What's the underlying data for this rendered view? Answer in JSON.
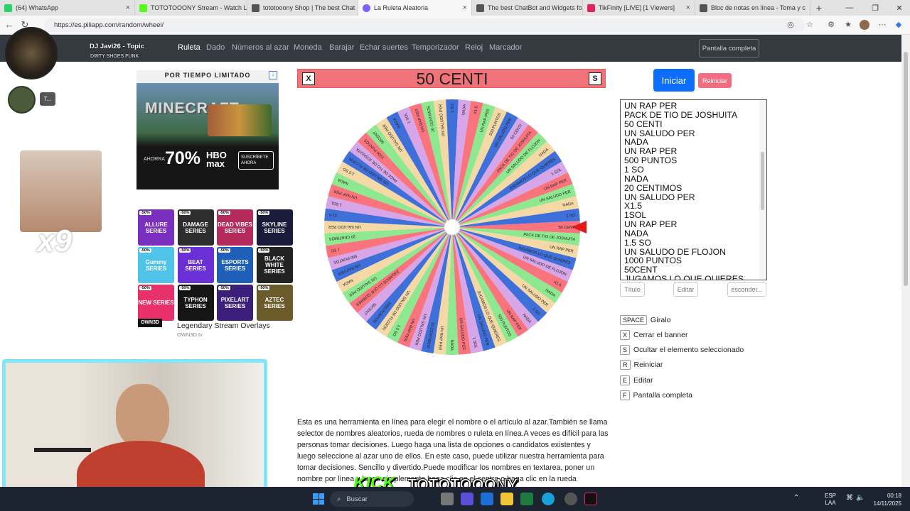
{
  "browser": {
    "tabs": [
      {
        "label": "(64) WhatsApp",
        "color": "#25d366"
      },
      {
        "label": "TOTOTOOONY Stream - Watch Li",
        "color": "#53fc18"
      },
      {
        "label": "tototooony Shop | The best Chat",
        "color": "#555555"
      },
      {
        "label": "La Ruleta Aleatoria",
        "color": "#7b61ff",
        "active": true
      },
      {
        "label": "The best ChatBot and Widgets fo",
        "color": "#555555"
      },
      {
        "label": "TikFinity [LIVE] [1 Viewers]",
        "color": "#e0245e"
      },
      {
        "label": "Bloc de notas en línea - Toma y c",
        "color": "#555555"
      }
    ],
    "url": "https://es.piliapp.com/random/wheel/"
  },
  "overlay": {
    "song_title": "DJ Javi26 - Topic",
    "song_subtitle": "DIRTY SHOES FUNK",
    "chat_badge": "T...",
    "emote_multiplier": "x9",
    "kick_watermark": "TOTOTOOONY"
  },
  "nav": {
    "links": [
      "Ruleta",
      "Dado",
      "Números al azar",
      "Moneda",
      "Barajar",
      "Echar suertes",
      "Temporizador",
      "Reloj",
      "Marcador"
    ],
    "fullscreen_label": "Pantalla completa"
  },
  "ads": {
    "ad1_tag": "POR TIEMPO LIMITADO",
    "ad1_game": "MINECRAFT",
    "ad1_discount": "70%",
    "ad1_save": "AHORRA",
    "ad1_brand": "HBO max",
    "ad1_cta": "SUSCRÍBETE AHORA",
    "ad2_tiles": [
      {
        "label": "ALLURE SERIES",
        "color": "#7a2fbf"
      },
      {
        "label": "DAMAGE SERIES",
        "color": "#2d2d2d"
      },
      {
        "label": "DEAD VIBES SERIES",
        "color": "#b42a5a"
      },
      {
        "label": "SKYLINE SERIES",
        "color": "#1a1a3a"
      },
      {
        "label": "Gummy SERIES",
        "color": "#4fc3e8"
      },
      {
        "label": "BEAT SERIES",
        "color": "#6b2fd6"
      },
      {
        "label": "ESPORTS SERIES",
        "color": "#1f5fb8"
      },
      {
        "label": "BLACK WHITE SERIES",
        "color": "#222222"
      },
      {
        "label": "NEW SERIES",
        "color": "#e8306a"
      },
      {
        "label": "TYPHON SERIES",
        "color": "#151515"
      },
      {
        "label": "PIXELART SERIES",
        "color": "#3b1f7a"
      },
      {
        "label": "AZTEC SERIES",
        "color": "#6b5a2a"
      }
    ],
    "ad2_discount": "-50%",
    "ad2_title": "Legendary Stream Overlays",
    "ad2_brand": "OWN3D",
    "ad2_domain": "OWN3D.tv"
  },
  "wheel": {
    "selected": "50 CENTI",
    "close_key": "X",
    "hide_key": "S",
    "colors": [
      "#f9747c",
      "#8de88f",
      "#f4d9a6",
      "#3f6fd8",
      "#d6a6e8"
    ],
    "segments": [
      "50 CENTI",
      "PACK DE TIO DE JOSHUITA",
      "UN RAP PER",
      "JUGAMOS LO QUE QUIERES",
      "UN SALUDO DE FLOJON",
      "X1.5",
      "NADA",
      "UN SALUDO PER",
      "1 SO",
      "NADA",
      "UN RAP PER",
      "500 PUNTOS",
      "JUGAMOS LO QUE QUIERES",
      "UN SALUDO PER",
      "1 SOL",
      "UN SALUDO PER",
      "NADA",
      "UN RAP PER",
      "20 CENTIMOS",
      "UN SALUDO PER",
      "UN RAP PER",
      "1.5 SO",
      "UN SALUDO DE FLOJON",
      "1000 PUNTOS",
      "50CENT",
      "JUGAMOS LO QUE QUIERES",
      "UN SALUDO PER",
      "NADA",
      "UN RAP PER",
      "500 PUNTOS",
      "1 SO",
      "20 CENTIMOS",
      "UN SALUDO PER",
      "X1.5",
      "1 SOL",
      "UN RAP PER",
      "NADA",
      "1.5 SO",
      "UN SALUDO DE FLOJON",
      "PACK DE TIO DE JOSHUITA",
      "1000 PUNTOS",
      "50CENT",
      "UN SALUDO PER",
      "NADA",
      "1 SOL",
      "UN RAP PER",
      "20 CENTIMOS",
      "UN SALUDO PER",
      "1 SO",
      "NADA",
      "X1.5",
      "UN RAP PER",
      "500 PUNTOS",
      "UN SALUDO PER",
      "50 CENTI",
      "PACK DE TIO DE JOSHUITA",
      "UN SALUDO DE FLOJON",
      "NADA",
      "JUGAMOS LO QUE QUIERES",
      "1 SOL",
      "UN RAP PER",
      "UN SALUDO PER",
      "NADA",
      "1 SO"
    ]
  },
  "controls": {
    "start": "Iniciar",
    "reset": "Reiniciar",
    "textarea_lines": [
      "UN RAP PER",
      "PACK DE TIO DE JOSHUITA",
      "50 CENTI",
      "UN SALUDO PER",
      "NADA",
      "UN RAP PER",
      "500 PUNTOS",
      "1 SO",
      "NADA",
      "20 CENTIMOS",
      "UN SALUDO PER",
      "X1.5",
      "1SOL",
      "UN RAP PER",
      "NADA",
      "1.5 SO",
      "UN SALUDO DE FLOJON",
      "1000 PUNTOS",
      "50CENT",
      "JUGAMOS LO QUE QUIERES"
    ],
    "title_btn": "Título",
    "edit_btn": "Editar",
    "hide_btn": "esconder..."
  },
  "shortcuts": [
    {
      "key": "SPACE",
      "label": "Gíralo"
    },
    {
      "key": "X",
      "label": "Cerrar el banner"
    },
    {
      "key": "S",
      "label": "Ocultar el elemento seleccionado"
    },
    {
      "key": "R",
      "label": "Reiniciar"
    },
    {
      "key": "E",
      "label": "Editar"
    },
    {
      "key": "F",
      "label": "Pantalla completa"
    }
  ],
  "description": "Esta es una herramienta en línea para elegir el nombre o el artículo al azar.También se llama selector de nombres aleatorios, rueda de nombres o ruleta en línea.A veces es difícil para las personas tomar decisiones. Luego haga una lista de opciones o candidatos existentes y luego seleccione al azar uno de ellos. En este caso, puede utilizar nuestra herramienta para tomar decisiones. Sencillo y divertido.Puede modificar los nombres en textarea, poner un nombre por línea y luego simplemente haga clic en el centro o haga clic en la rueda",
  "taskbar": {
    "search": "Buscar",
    "lang1": "ESP",
    "lang2": "LAA",
    "time": "00:18",
    "date": "14/11/2025"
  }
}
